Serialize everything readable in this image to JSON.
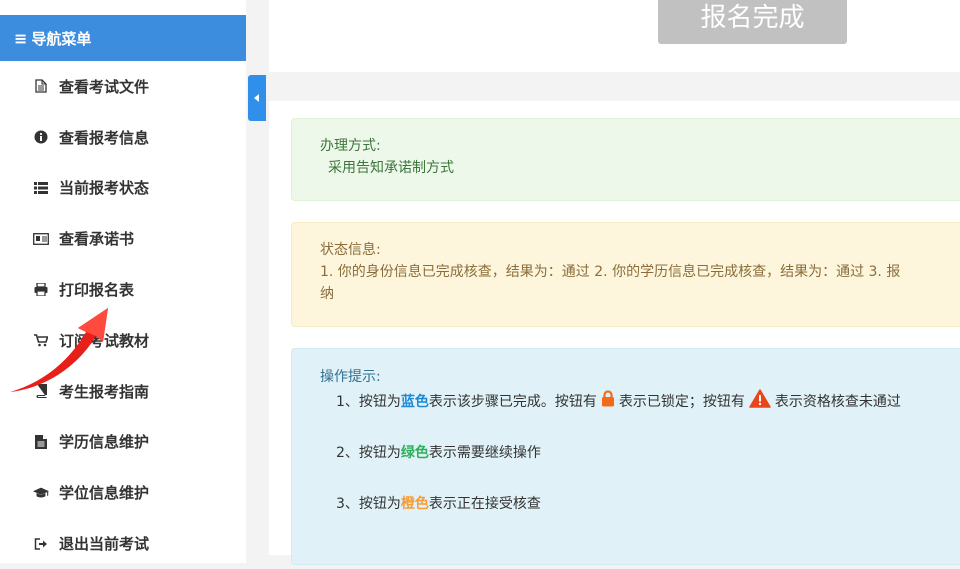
{
  "sidebar": {
    "header": {
      "icon": "bars-icon",
      "label": "导航菜单"
    },
    "items": [
      {
        "icon": "file-text-icon",
        "label": "查看考试文件"
      },
      {
        "icon": "info-circle-icon",
        "label": "查看报考信息"
      },
      {
        "icon": "list-icon",
        "label": "当前报考状态"
      },
      {
        "icon": "id-card-icon",
        "label": "查看承诺书"
      },
      {
        "icon": "printer-icon",
        "label": "打印报名表"
      },
      {
        "icon": "cart-icon",
        "label": "订阅考试教材"
      },
      {
        "icon": "book-icon",
        "label": "考生报考指南"
      },
      {
        "icon": "document-icon",
        "label": "学历信息维护"
      },
      {
        "icon": "graduation-cap-icon",
        "label": "学位信息维护"
      },
      {
        "icon": "sign-out-icon",
        "label": "退出当前考试"
      }
    ]
  },
  "main": {
    "register_done_button": "报名完成",
    "handling": {
      "title": "办理方式:",
      "value": "采用告知承诺制方式"
    },
    "status": {
      "title": "状态信息:",
      "line1": "1. 你的身份信息已完成核查，结果为：通过 2. 你的学历信息已完成核查，结果为：通过 3. 报",
      "line2": "纳"
    },
    "tips": {
      "title": "操作提示:",
      "t1_prefix": "1、按钮为",
      "t1_color": "蓝色",
      "t1_mid": "表示该步骤已完成。按钮有",
      "t1_mid2": "表示已锁定；按钮有",
      "t1_suffix": "表示资格核查未通过",
      "t2_prefix": "2、按钮为",
      "t2_color": "绿色",
      "t2_suffix": "表示需要继续操作",
      "t3_prefix": "3、按钮为",
      "t3_color": "橙色",
      "t3_suffix": "表示正在接受核查"
    }
  },
  "colors": {
    "nav_header": "#3c8dde",
    "blue_text": "#1e8ad4",
    "green_text": "#2fb05c",
    "orange_text": "#f59d3a",
    "lock": "#f26b1d",
    "warning": "#e8461a"
  }
}
